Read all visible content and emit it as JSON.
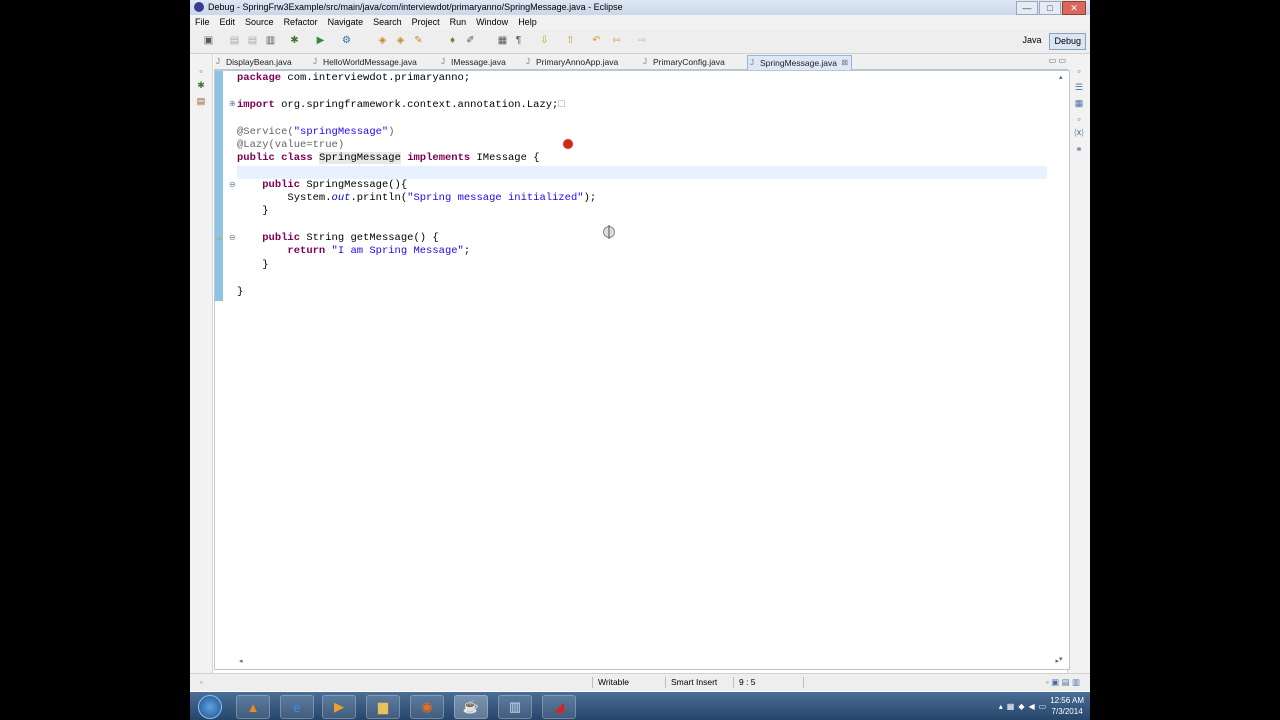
{
  "window": {
    "title": "Debug - SpringFrw3Example/src/main/java/com/interviewdot/primaryanno/SpringMessage.java - Eclipse",
    "controls": {
      "minimize": "—",
      "maximize": "□",
      "close": "✕"
    }
  },
  "menu": [
    "File",
    "Edit",
    "Source",
    "Refactor",
    "Navigate",
    "Search",
    "Project",
    "Run",
    "Window",
    "Help"
  ],
  "perspectives": {
    "java": "Java",
    "debug": "Debug"
  },
  "tabs": [
    {
      "label": "DisplayBean.java"
    },
    {
      "label": "HelloWorldMessage.java"
    },
    {
      "label": "IMessage.java"
    },
    {
      "label": "PrimaryAnnoApp.java"
    },
    {
      "label": "PrimaryConfig.java"
    },
    {
      "label": "SpringMessage.java",
      "active": true
    }
  ],
  "code": {
    "line1_kw": "package",
    "line1_rest": " com.interviewdot.primaryanno;",
    "line2_kw": "import",
    "line2_rest": " org.springframework.context.annotation.Lazy;",
    "line2_fold": "□",
    "line3_ann": "@Service(",
    "line3_str": "\"springMessage\"",
    "line3_close": ")",
    "line4": "@Lazy(value=true)",
    "line5_kw1": "public",
    "line5_kw2": "class",
    "line5_name": "SpringMessage",
    "line5_kw3": "implements",
    "line5_rest": " IMessage {",
    "line6_kw": "public",
    "line6_rest": " SpringMessage(){",
    "line7_pre": "System.",
    "line7_fld": "out",
    "line7_mid": ".println(",
    "line7_str": "\"Spring message initialized\"",
    "line7_end": ");",
    "line8": "}",
    "line9_kw": "public",
    "line9_rest": " String getMessage() {",
    "line10_kw": "return",
    "line10_str": " \"I am Spring Message\"",
    "line10_end": ";",
    "line11": "}",
    "line12": "}"
  },
  "status": {
    "writable": "Writable",
    "insert_mode": "Smart Insert",
    "position": "9 : 5"
  },
  "clock": {
    "time": "12:56 AM",
    "date": "7/3/2014"
  },
  "colors": {
    "keyword": "#7f0055",
    "string": "#2a00ff",
    "annotation": "#646464",
    "field": "#0000c0",
    "ruler": "#8fc3e4"
  }
}
